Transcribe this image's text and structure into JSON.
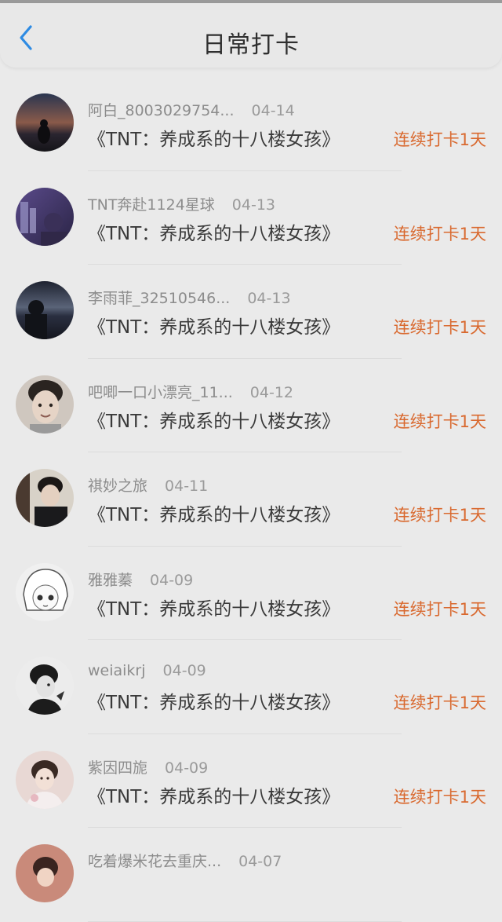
{
  "header": {
    "title": "日常打卡",
    "back_icon": "chevron-left-icon"
  },
  "colors": {
    "accent_back": "#2e8be3",
    "streak": "#d9692f"
  },
  "entries": [
    {
      "user": "阿白_8003029754...",
      "date": "04-14",
      "book": "《TNT：养成系的十八楼女孩》",
      "streak": "连续打卡1天"
    },
    {
      "user": "TNT奔赴1124星球",
      "date": "04-13",
      "book": "《TNT：养成系的十八楼女孩》",
      "streak": "连续打卡1天"
    },
    {
      "user": "李雨菲_32510546...",
      "date": "04-13",
      "book": "《TNT：养成系的十八楼女孩》",
      "streak": "连续打卡1天"
    },
    {
      "user": "吧唧一口小漂亮_11...",
      "date": "04-12",
      "book": "《TNT：养成系的十八楼女孩》",
      "streak": "连续打卡1天"
    },
    {
      "user": "祺妙之旅",
      "date": "04-11",
      "book": "《TNT：养成系的十八楼女孩》",
      "streak": "连续打卡1天"
    },
    {
      "user": "雅雅蓁",
      "date": "04-09",
      "book": "《TNT：养成系的十八楼女孩》",
      "streak": "连续打卡1天"
    },
    {
      "user": "weiaikrj",
      "date": "04-09",
      "book": "《TNT：养成系的十八楼女孩》",
      "streak": "连续打卡1天"
    },
    {
      "user": "紫因四旎",
      "date": "04-09",
      "book": "《TNT：养成系的十八楼女孩》",
      "streak": "连续打卡1天"
    },
    {
      "user": "吃着爆米花去重庆...",
      "date": "04-07",
      "book": "",
      "streak": ""
    }
  ]
}
